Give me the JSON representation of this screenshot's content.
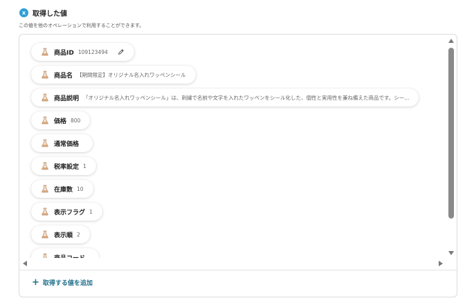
{
  "header": {
    "icon_glyph": "x",
    "title": "取得した値",
    "subtitle": "この値を他のオペレーションで利用することができます。"
  },
  "items": [
    {
      "label": "商品ID",
      "value": "109123494",
      "editable": true
    },
    {
      "label": "商品名",
      "value": "【期間限定】オリジナル名入れワッペンシール"
    },
    {
      "label": "商品説明",
      "value": "「オリジナル名入れワッペンシール」は、刺繍で名前や文字を入れたワッペンをシール化した、個性と実用性を兼ね備えた商品です。シー..."
    },
    {
      "label": "価格",
      "value": "800"
    },
    {
      "label": "通常価格",
      "value": ""
    },
    {
      "label": "税率設定",
      "value": "1"
    },
    {
      "label": "在庫数",
      "value": "10"
    },
    {
      "label": "表示フラグ",
      "value": "1"
    },
    {
      "label": "表示順",
      "value": "2"
    },
    {
      "label": "商品コード",
      "value": ""
    }
  ],
  "add_button": {
    "label": "取得する値を追加"
  },
  "icons": {
    "header": "info-badge-icon",
    "item": "flask-icon",
    "edit": "pencil-icon",
    "add": "plus-icon"
  },
  "colors": {
    "accent": "#2f9fd6",
    "link": "#1f6f8b",
    "scrollbar": "#8a8a8a"
  }
}
